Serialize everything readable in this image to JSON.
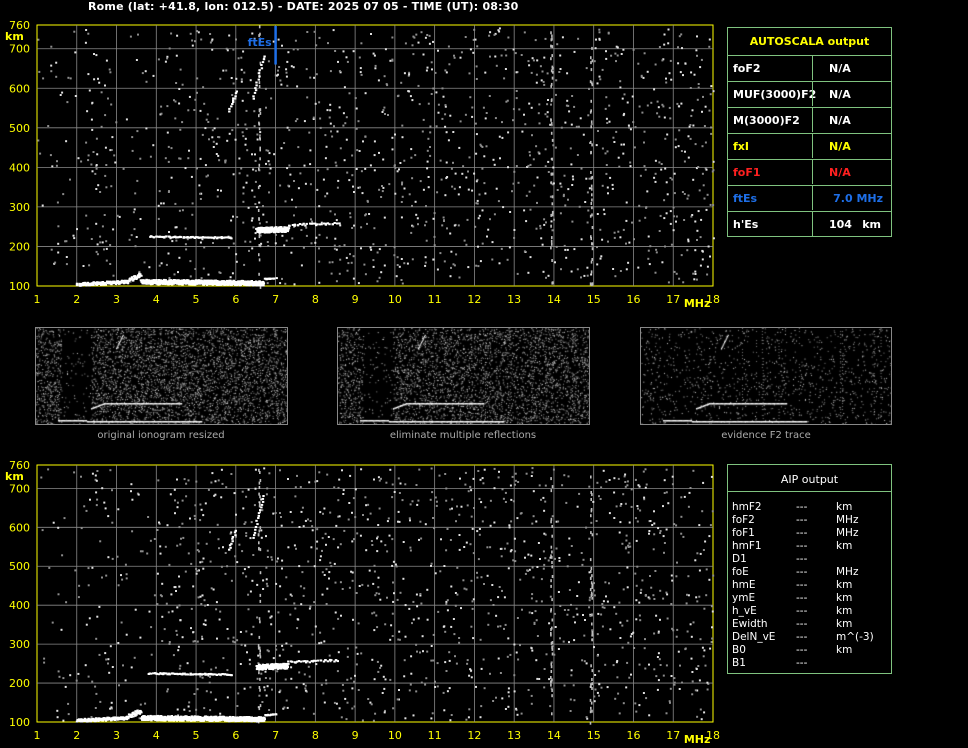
{
  "header": "Rome (lat: +41.8, lon: 012.5) - DATE: 2025 07 05 - TIME (UT): 08:30",
  "ionogram": {
    "y_unit": "km",
    "x_unit": "MHz",
    "y_ticks": [
      "100",
      "200",
      "300",
      "400",
      "500",
      "600",
      "700",
      "760"
    ],
    "x_ticks": [
      "1",
      "2",
      "3",
      "4",
      "5",
      "6",
      "7",
      "8",
      "9",
      "10",
      "11",
      "12",
      "13",
      "14",
      "15",
      "16",
      "17",
      "18"
    ],
    "ftes_marker_label": "ftEs",
    "ftes_marker_freq": 7.0,
    "colors": {
      "grid": "#8a8a8a",
      "axis_labels": "#ffff00",
      "marker": "#1e6fe8",
      "panel_border": "#7fc27f"
    }
  },
  "autoscala": {
    "title": "AUTOSCALA output",
    "rows": [
      {
        "label": "foF2",
        "value": "N/A",
        "label_color": "#ffffff",
        "value_color": "#ffffff"
      },
      {
        "label": "MUF(3000)F2",
        "value": "N/A",
        "label_color": "#ffffff",
        "value_color": "#ffffff"
      },
      {
        "label": "M(3000)F2",
        "value": "N/A",
        "label_color": "#ffffff",
        "value_color": "#ffffff"
      },
      {
        "label": "fxI",
        "value": "N/A",
        "label_color": "#ffff00",
        "value_color": "#ffff00"
      },
      {
        "label": "foF1",
        "value": "N/A",
        "label_color": "#ff2020",
        "value_color": "#ff2020"
      },
      {
        "label": "ftEs",
        "value": "7.0 MHz",
        "label_color": "#1e6fe8",
        "value_color": "#1e6fe8"
      },
      {
        "label": "h'Es",
        "value": "104",
        "unit": "km",
        "label_color": "#ffffff",
        "value_color": "#ffffff"
      }
    ]
  },
  "thumbnails": [
    {
      "caption": "original ionogram resized"
    },
    {
      "caption": "eliminate multiple reflections"
    },
    {
      "caption": "evidence F2 trace"
    }
  ],
  "aip": {
    "title": "AIP output",
    "rows": [
      {
        "param": "hmF2",
        "value": "---",
        "unit": "km"
      },
      {
        "param": "foF2",
        "value": "---",
        "unit": "MHz"
      },
      {
        "param": "foF1",
        "value": "---",
        "unit": "MHz"
      },
      {
        "param": "hmF1",
        "value": "---",
        "unit": "km"
      },
      {
        "param": "D1",
        "value": "---",
        "unit": ""
      },
      {
        "param": "foE",
        "value": "---",
        "unit": "MHz"
      },
      {
        "param": "hmE",
        "value": "---",
        "unit": "km"
      },
      {
        "param": "ymE",
        "value": "---",
        "unit": "km"
      },
      {
        "param": "h_vE",
        "value": "---",
        "unit": "km"
      },
      {
        "param": "Ewidth",
        "value": "---",
        "unit": "km"
      },
      {
        "param": "DelN_vE",
        "value": "---",
        "unit": "m^(-3)"
      },
      {
        "param": "B0",
        "value": "---",
        "unit": "km"
      },
      {
        "param": "B1",
        "value": "---",
        "unit": ""
      }
    ]
  }
}
